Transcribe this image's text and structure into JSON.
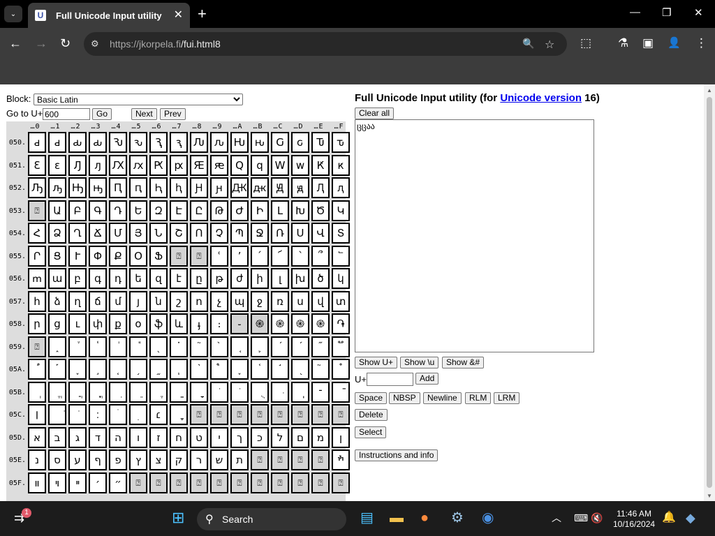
{
  "browser": {
    "tab_title": "Full Unicode Input utility",
    "tab_favicon": "U",
    "url_host": "https://jkorpela.fi",
    "url_path": "/fui.html8"
  },
  "icons": {
    "tab_search": "⌄",
    "tab_close": "✕",
    "new_tab": "+",
    "minimize": "—",
    "restore": "❐",
    "close": "✕",
    "back": "←",
    "forward": "→",
    "reload": "↻",
    "site_info": "⚙",
    "zoom": "🔍",
    "star": "☆",
    "extensions": "⬚",
    "labs": "⚗",
    "sidebar": "▣",
    "profile": "👤",
    "menu": "⋮",
    "start": "⊞",
    "search": "⚲"
  },
  "form": {
    "block_label": "Block:",
    "block_value": "Basic Latin",
    "goto_label": "Go to U+",
    "goto_value": "600",
    "go_button": "Go",
    "next_button": "Next",
    "prev_button": "Prev"
  },
  "grid": {
    "col_headers": [
      "…0",
      "…1",
      "…2",
      "…3",
      "…4",
      "…5",
      "…6",
      "…7",
      "…8",
      "…9",
      "…A",
      "…B",
      "…C",
      "…D",
      "…E",
      "…F"
    ],
    "rows": [
      {
        "label": "050.",
        "cells": [
          "ԁ",
          "ԁ",
          "ԃ",
          "ԃ",
          "Ԅ",
          "ԅ",
          "Ԇ",
          "ԇ",
          "Ԉ",
          "ԉ",
          "Ԋ",
          "ԋ",
          "Ԍ",
          "ԍ",
          "Ԏ",
          "ԏ"
        ],
        "gray": []
      },
      {
        "label": "051.",
        "cells": [
          "Ԑ",
          "ԑ",
          "Ԓ",
          "ԓ",
          "Ԕ",
          "ԕ",
          "Ԗ",
          "ԗ",
          "Ԙ",
          "ԙ",
          "Ԛ",
          "ԛ",
          "Ԝ",
          "ԝ",
          "Ԟ",
          "ԟ"
        ],
        "gray": []
      },
      {
        "label": "052.",
        "cells": [
          "Ԡ",
          "ԡ",
          "Ԣ",
          "ԣ",
          "Ԥ",
          "ԥ",
          "Ԧ",
          "ԧ",
          "Ԩ",
          "ԩ",
          "Ԫ",
          "ԫ",
          "Ԭ",
          "ԭ",
          "Ԯ",
          "ԯ"
        ],
        "gray": []
      },
      {
        "label": "053.",
        "cells": [
          "⍰",
          "Ա",
          "Բ",
          "Գ",
          "Դ",
          "Ե",
          "Զ",
          "Է",
          "Ը",
          "Թ",
          "Ժ",
          "Ի",
          "Լ",
          "Խ",
          "Ծ",
          "Կ"
        ],
        "gray": [
          0
        ]
      },
      {
        "label": "054.",
        "cells": [
          "Հ",
          "Ձ",
          "Ղ",
          "Ճ",
          "Մ",
          "Յ",
          "Ն",
          "Շ",
          "Ո",
          "Չ",
          "Պ",
          "Ջ",
          "Ռ",
          "Ս",
          "Վ",
          "Տ"
        ],
        "gray": []
      },
      {
        "label": "055.",
        "cells": [
          "Ր",
          "Ց",
          "Ւ",
          "Փ",
          "Ք",
          "Օ",
          "Ֆ",
          "⍰",
          "⍰",
          "ՙ",
          "՚",
          "՛",
          "՜",
          "՝",
          "՞",
          "՟"
        ],
        "gray": [
          7,
          8
        ]
      },
      {
        "label": "056.",
        "cells": [
          "ՠ",
          "ա",
          "բ",
          "գ",
          "դ",
          "ե",
          "զ",
          "է",
          "ը",
          "թ",
          "ժ",
          "ի",
          "լ",
          "խ",
          "ծ",
          "կ"
        ],
        "gray": []
      },
      {
        "label": "057.",
        "cells": [
          "հ",
          "ձ",
          "ղ",
          "ճ",
          "մ",
          "յ",
          "ն",
          "շ",
          "ո",
          "չ",
          "պ",
          "ջ",
          "ռ",
          "ս",
          "վ",
          "տ"
        ],
        "gray": []
      },
      {
        "label": "058.",
        "cells": [
          "ր",
          "ց",
          "ւ",
          "փ",
          "ք",
          "օ",
          "ֆ",
          "և",
          "ֈ",
          "։",
          "֊",
          "֍",
          "֎",
          "֍",
          "֎",
          "֏"
        ],
        "gray": [
          10,
          11
        ]
      },
      {
        "label": "059.",
        "cells": [
          "⍰",
          "֑",
          "֒",
          "֓",
          "֔",
          "֕",
          "֖",
          "֗",
          "֘",
          "֙",
          "֚",
          "֛",
          "֜",
          "֝",
          "֞",
          "֟"
        ],
        "gray": [
          0
        ]
      },
      {
        "label": "05A.",
        "cells": [
          "֠",
          "֡",
          "֢",
          "֣",
          "֤",
          "֥",
          "֦",
          "֧",
          "֨",
          "֩",
          "֪",
          "֫",
          "֬",
          "֭",
          "֮",
          "֯"
        ],
        "gray": []
      },
      {
        "label": "05B.",
        "cells": [
          "ְ",
          "ֱ",
          "ֲ",
          "ֳ",
          "ִ",
          "ֵ",
          "ֶ",
          "ַ",
          "ָ",
          "ֹ",
          "ֺ",
          "ֻ",
          "ּ",
          "ֽ",
          "־",
          "ֿ"
        ],
        "gray": []
      },
      {
        "label": "05C.",
        "cells": [
          "׀",
          "ׁ",
          "ׂ",
          "׃",
          "ׄ",
          "ׅ",
          "׆",
          "ׇ",
          "⍰",
          "⍰",
          "⍰",
          "⍰",
          "⍰",
          "⍰",
          "⍰",
          "⍰"
        ],
        "gray": [
          8,
          9,
          10,
          11,
          12,
          13,
          14,
          15
        ]
      },
      {
        "label": "05D.",
        "cells": [
          "א",
          "ב",
          "ג",
          "ד",
          "ה",
          "ו",
          "ז",
          "ח",
          "ט",
          "י",
          "ך",
          "כ",
          "ל",
          "ם",
          "מ",
          "ן"
        ],
        "gray": []
      },
      {
        "label": "05E.",
        "cells": [
          "נ",
          "ס",
          "ע",
          "ף",
          "פ",
          "ץ",
          "צ",
          "ק",
          "ר",
          "ש",
          "ת",
          "⍰",
          "⍰",
          "⍰",
          "⍰",
          "ׯ"
        ],
        "gray": [
          11,
          12,
          13,
          14
        ]
      },
      {
        "label": "05F.",
        "cells": [
          "װ",
          "ױ",
          "ײ",
          "׳",
          "״",
          "⍰",
          "⍰",
          "⍰",
          "⍰",
          "⍰",
          "⍰",
          "⍰",
          "⍰",
          "⍰",
          "⍰",
          "⍰"
        ],
        "gray": [
          5,
          6,
          7,
          8,
          9,
          10,
          11,
          12,
          13,
          14,
          15
        ]
      }
    ]
  },
  "right": {
    "title_prefix": "Full Unicode Input utility (for ",
    "title_link": "Unicode version",
    "title_suffix": " 16)",
    "clear_all": "Clear all",
    "output_text": "ცცაა",
    "show_uplus": "Show U+",
    "show_u": "Show \\u",
    "show_amp": "Show &#",
    "uplus_label": "U+",
    "uplus_value": "",
    "add": "Add",
    "space": "Space",
    "nbsp": "NBSP",
    "newline": "Newline",
    "rlm": "RLM",
    "lrm": "LRM",
    "delete": "Delete",
    "select": "Select",
    "instructions": "Instructions and info"
  },
  "taskbar": {
    "search_label": "Search",
    "time": "11:46 AM",
    "date": "10/16/2024",
    "badge_count": "1"
  }
}
